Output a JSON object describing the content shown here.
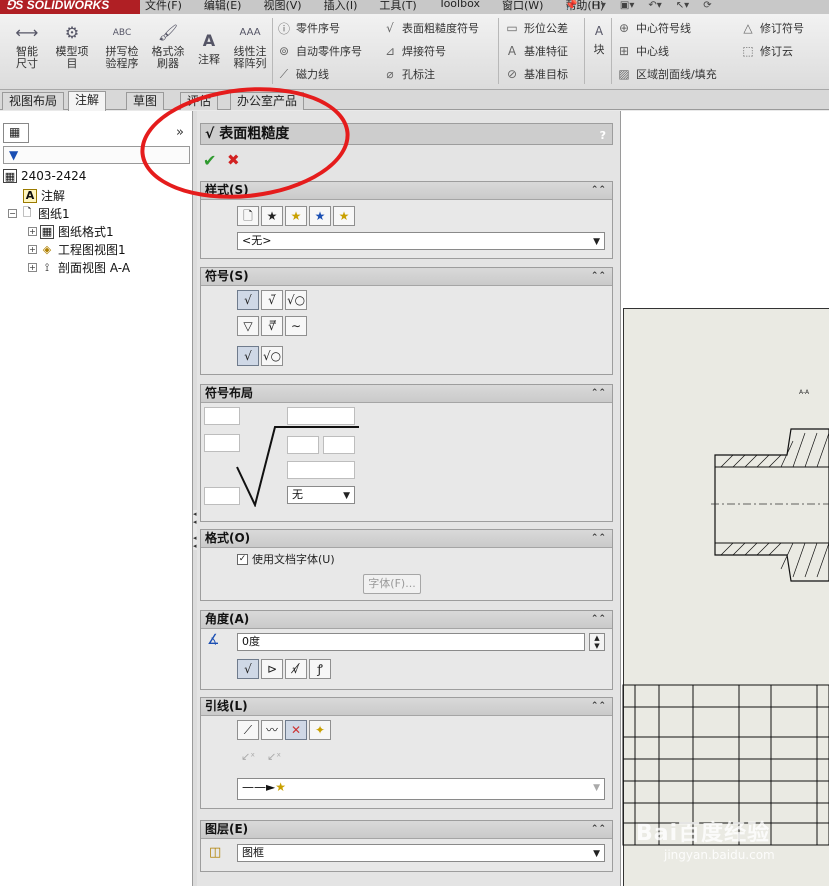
{
  "app": {
    "logo": "⅁S SOLIDWORKS"
  },
  "menu": [
    "文件(F)",
    "编辑(E)",
    "视图(V)",
    "插入(I)",
    "工具(T)",
    "Toolbox",
    "窗口(W)",
    "帮助(H)"
  ],
  "ribbon": {
    "smart_dim": "智能尺寸",
    "model_items": "模型项目",
    "spell_check": "拼写检验程序",
    "format_painter": "格式涂刷器",
    "note": "注释",
    "linear_note": "线性注释阵列",
    "balloon": "零件序号",
    "auto_balloon": "自动零件序号",
    "magnetic_line": "磁力线",
    "surface_finish": "表面粗糙度符号",
    "weld_symbol": "焊接符号",
    "hole_callout": "孔标注",
    "geo_tol": "形位公差",
    "datum_feature": "基准特征",
    "datum_target": "基准目标",
    "block": "块",
    "center_mark": "中心符号线",
    "centerline": "中心线",
    "area_hatch": "区域剖面线/填充",
    "revision_symbol": "修订符号",
    "revision_cloud": "修订云"
  },
  "tabs": [
    "视图布局",
    "注解",
    "草图",
    "评估",
    "办公室产品"
  ],
  "active_tab": "注解",
  "tree": {
    "filter_placeholder": "",
    "root": "2403-2424",
    "annotations": "注解",
    "sheet": "图纸1",
    "sheet_format": "图纸格式1",
    "drawing_view": "工程图视图1",
    "section_view": "剖面视图 A-A"
  },
  "pm": {
    "title": "表面粗糙度",
    "help": "?",
    "ok": "✔",
    "cancel": "✖",
    "style_section": "样式(S)",
    "style_value": "<无>",
    "symbol_section": "符号(S)",
    "layout_section": "符号布局",
    "layout_lay_value": "无",
    "format_section": "格式(O)",
    "use_doc_font": "使用文档字体(U)",
    "font_button": "字体(F)...",
    "angle_section": "角度(A)",
    "angle_value": "0度",
    "leader_section": "引线(L)",
    "layer_section": "图层(E)",
    "layer_value": "图框"
  },
  "watermark": {
    "main": "Bai百度经验",
    "url": "jingyan.baidu.com"
  },
  "colors": {
    "annotation_circle": "#e51c1c",
    "logo_bg": "#b01f24"
  }
}
